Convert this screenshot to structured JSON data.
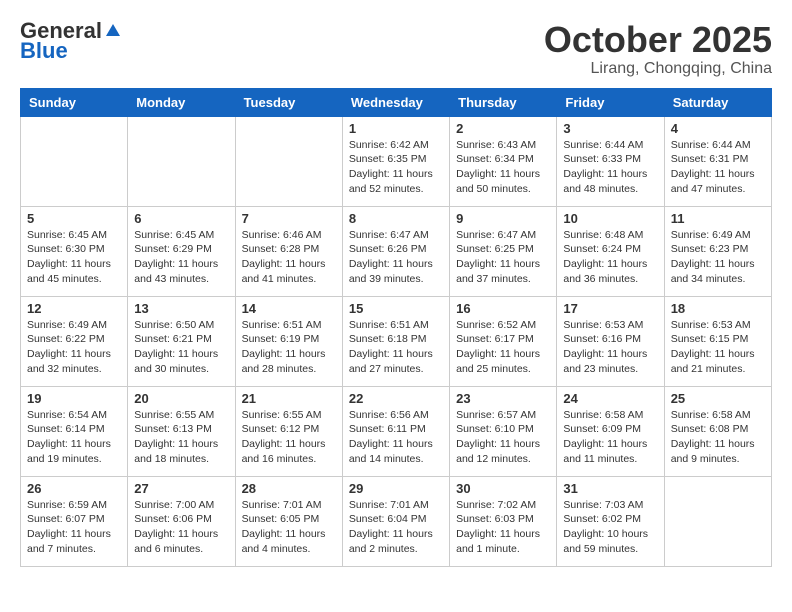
{
  "header": {
    "logo_general": "General",
    "logo_blue": "Blue",
    "month_title": "October 2025",
    "location": "Lirang, Chongqing, China"
  },
  "weekdays": [
    "Sunday",
    "Monday",
    "Tuesday",
    "Wednesday",
    "Thursday",
    "Friday",
    "Saturday"
  ],
  "weeks": [
    [
      {
        "day": "",
        "info": ""
      },
      {
        "day": "",
        "info": ""
      },
      {
        "day": "",
        "info": ""
      },
      {
        "day": "1",
        "info": "Sunrise: 6:42 AM\nSunset: 6:35 PM\nDaylight: 11 hours\nand 52 minutes."
      },
      {
        "day": "2",
        "info": "Sunrise: 6:43 AM\nSunset: 6:34 PM\nDaylight: 11 hours\nand 50 minutes."
      },
      {
        "day": "3",
        "info": "Sunrise: 6:44 AM\nSunset: 6:33 PM\nDaylight: 11 hours\nand 48 minutes."
      },
      {
        "day": "4",
        "info": "Sunrise: 6:44 AM\nSunset: 6:31 PM\nDaylight: 11 hours\nand 47 minutes."
      }
    ],
    [
      {
        "day": "5",
        "info": "Sunrise: 6:45 AM\nSunset: 6:30 PM\nDaylight: 11 hours\nand 45 minutes."
      },
      {
        "day": "6",
        "info": "Sunrise: 6:45 AM\nSunset: 6:29 PM\nDaylight: 11 hours\nand 43 minutes."
      },
      {
        "day": "7",
        "info": "Sunrise: 6:46 AM\nSunset: 6:28 PM\nDaylight: 11 hours\nand 41 minutes."
      },
      {
        "day": "8",
        "info": "Sunrise: 6:47 AM\nSunset: 6:26 PM\nDaylight: 11 hours\nand 39 minutes."
      },
      {
        "day": "9",
        "info": "Sunrise: 6:47 AM\nSunset: 6:25 PM\nDaylight: 11 hours\nand 37 minutes."
      },
      {
        "day": "10",
        "info": "Sunrise: 6:48 AM\nSunset: 6:24 PM\nDaylight: 11 hours\nand 36 minutes."
      },
      {
        "day": "11",
        "info": "Sunrise: 6:49 AM\nSunset: 6:23 PM\nDaylight: 11 hours\nand 34 minutes."
      }
    ],
    [
      {
        "day": "12",
        "info": "Sunrise: 6:49 AM\nSunset: 6:22 PM\nDaylight: 11 hours\nand 32 minutes."
      },
      {
        "day": "13",
        "info": "Sunrise: 6:50 AM\nSunset: 6:21 PM\nDaylight: 11 hours\nand 30 minutes."
      },
      {
        "day": "14",
        "info": "Sunrise: 6:51 AM\nSunset: 6:19 PM\nDaylight: 11 hours\nand 28 minutes."
      },
      {
        "day": "15",
        "info": "Sunrise: 6:51 AM\nSunset: 6:18 PM\nDaylight: 11 hours\nand 27 minutes."
      },
      {
        "day": "16",
        "info": "Sunrise: 6:52 AM\nSunset: 6:17 PM\nDaylight: 11 hours\nand 25 minutes."
      },
      {
        "day": "17",
        "info": "Sunrise: 6:53 AM\nSunset: 6:16 PM\nDaylight: 11 hours\nand 23 minutes."
      },
      {
        "day": "18",
        "info": "Sunrise: 6:53 AM\nSunset: 6:15 PM\nDaylight: 11 hours\nand 21 minutes."
      }
    ],
    [
      {
        "day": "19",
        "info": "Sunrise: 6:54 AM\nSunset: 6:14 PM\nDaylight: 11 hours\nand 19 minutes."
      },
      {
        "day": "20",
        "info": "Sunrise: 6:55 AM\nSunset: 6:13 PM\nDaylight: 11 hours\nand 18 minutes."
      },
      {
        "day": "21",
        "info": "Sunrise: 6:55 AM\nSunset: 6:12 PM\nDaylight: 11 hours\nand 16 minutes."
      },
      {
        "day": "22",
        "info": "Sunrise: 6:56 AM\nSunset: 6:11 PM\nDaylight: 11 hours\nand 14 minutes."
      },
      {
        "day": "23",
        "info": "Sunrise: 6:57 AM\nSunset: 6:10 PM\nDaylight: 11 hours\nand 12 minutes."
      },
      {
        "day": "24",
        "info": "Sunrise: 6:58 AM\nSunset: 6:09 PM\nDaylight: 11 hours\nand 11 minutes."
      },
      {
        "day": "25",
        "info": "Sunrise: 6:58 AM\nSunset: 6:08 PM\nDaylight: 11 hours\nand 9 minutes."
      }
    ],
    [
      {
        "day": "26",
        "info": "Sunrise: 6:59 AM\nSunset: 6:07 PM\nDaylight: 11 hours\nand 7 minutes."
      },
      {
        "day": "27",
        "info": "Sunrise: 7:00 AM\nSunset: 6:06 PM\nDaylight: 11 hours\nand 6 minutes."
      },
      {
        "day": "28",
        "info": "Sunrise: 7:01 AM\nSunset: 6:05 PM\nDaylight: 11 hours\nand 4 minutes."
      },
      {
        "day": "29",
        "info": "Sunrise: 7:01 AM\nSunset: 6:04 PM\nDaylight: 11 hours\nand 2 minutes."
      },
      {
        "day": "30",
        "info": "Sunrise: 7:02 AM\nSunset: 6:03 PM\nDaylight: 11 hours\nand 1 minute."
      },
      {
        "day": "31",
        "info": "Sunrise: 7:03 AM\nSunset: 6:02 PM\nDaylight: 10 hours\nand 59 minutes."
      },
      {
        "day": "",
        "info": ""
      }
    ]
  ]
}
